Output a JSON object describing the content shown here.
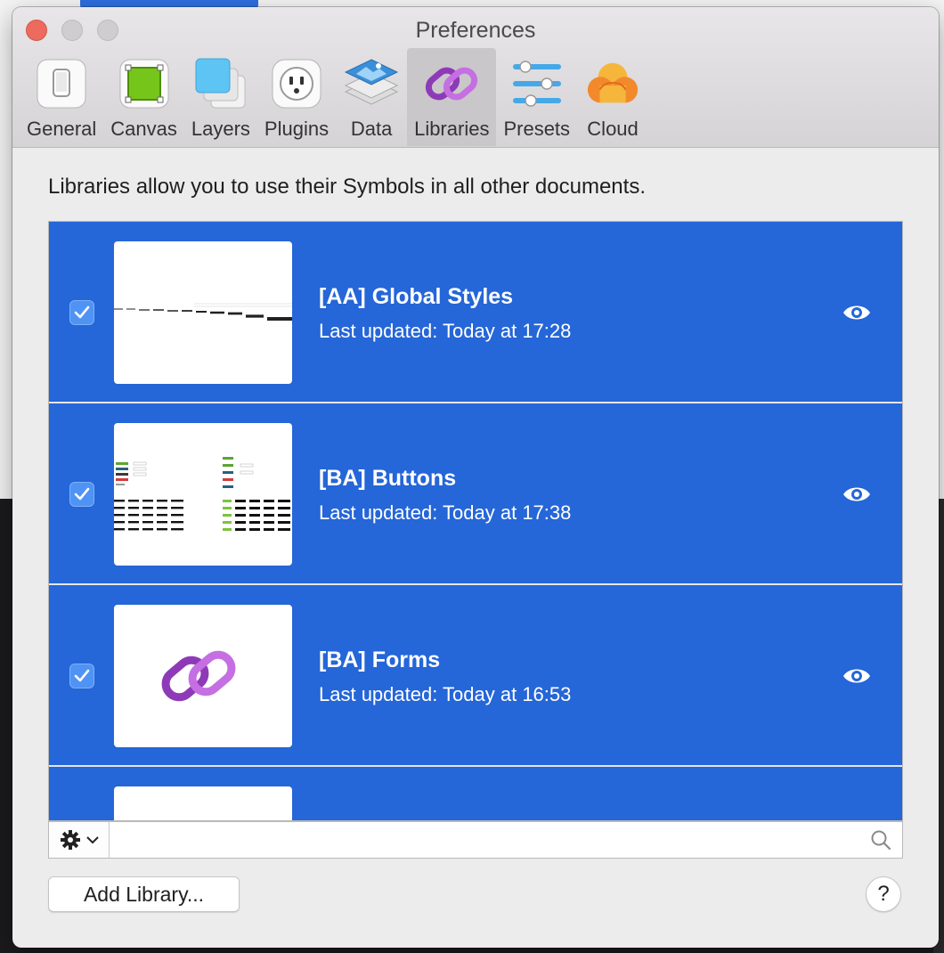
{
  "window": {
    "title": "Preferences"
  },
  "toolbar": {
    "items": [
      {
        "label": "General",
        "icon": "general-icon"
      },
      {
        "label": "Canvas",
        "icon": "canvas-icon"
      },
      {
        "label": "Layers",
        "icon": "layers-icon"
      },
      {
        "label": "Plugins",
        "icon": "plugins-icon"
      },
      {
        "label": "Data",
        "icon": "data-icon"
      },
      {
        "label": "Libraries",
        "icon": "libraries-icon",
        "active": true
      },
      {
        "label": "Presets",
        "icon": "presets-icon"
      },
      {
        "label": "Cloud",
        "icon": "cloud-icon"
      }
    ]
  },
  "main": {
    "description": "Libraries allow you to use their Symbols in all other documents.",
    "libraries": [
      {
        "name": "[AA] Global Styles",
        "updated": "Last updated: Today at 17:28",
        "enabled": true
      },
      {
        "name": "[BA] Buttons",
        "updated": "Last updated: Today at 17:38",
        "enabled": true
      },
      {
        "name": "[BA] Forms",
        "updated": "Last updated: Today at 16:53",
        "enabled": true
      }
    ]
  },
  "footer": {
    "add_label": "Add Library...",
    "help_label": "?"
  },
  "colors": {
    "selection": "#2566d8",
    "checkbox": "#4f93f5",
    "close_button": "#ed6a5e"
  }
}
